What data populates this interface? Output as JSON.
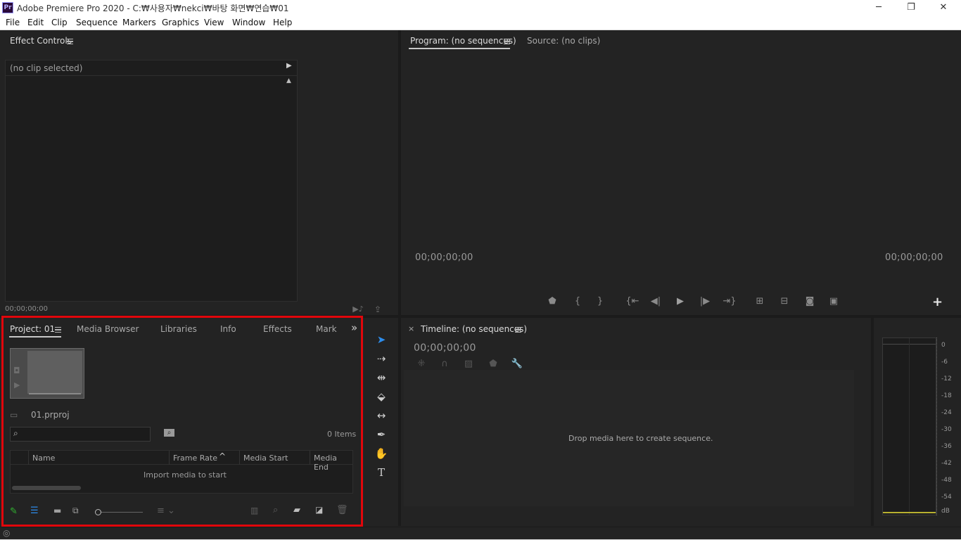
{
  "window": {
    "title": "Adobe Premiere Pro 2020 - C:₩사용자₩nekci₩바탕 화면₩연습₩01",
    "app_icon": "Pr",
    "minimize_icon": "─",
    "restore_icon": "❐",
    "close_icon": "✕"
  },
  "menu": [
    "File",
    "Edit",
    "Clip",
    "Sequence",
    "Markers",
    "Graphics",
    "View",
    "Window",
    "Help"
  ],
  "effect_controls": {
    "tab_label": "Effect Controls",
    "clip_selector": "(no clip selected)",
    "timecode": "00;00;00;00"
  },
  "program_monitor": {
    "tab_program": "Program: (no sequences)",
    "tab_source": "Source: (no clips)",
    "timecode_left": "00;00;00;00",
    "timecode_right": "00;00;00;00",
    "controls": [
      "marker-icon",
      "mark-in-icon",
      "mark-out-icon",
      "go-to-in-icon",
      "step-back-icon",
      "play-icon",
      "step-forward-icon",
      "go-to-out-icon",
      "lift-icon",
      "extract-icon",
      "export-frame-icon",
      "comparison-view-icon"
    ],
    "add_icon": "+"
  },
  "project": {
    "tabs": [
      "Project: 01",
      "Media Browser",
      "Libraries",
      "Info",
      "Effects",
      "Mark"
    ],
    "overflow_icon": "»",
    "filename": "01.prproj",
    "search_placeholder": "",
    "items_count": "0 Items",
    "columns": [
      "Name",
      "Frame Rate",
      "Media Start",
      "Media End"
    ],
    "empty_message": "Import media to start",
    "thumbnail_zoom": 0.0
  },
  "tools": [
    "selection-tool-icon",
    "track-select-tool-icon",
    "ripple-edit-tool-icon",
    "razor-tool-icon",
    "slip-tool-icon",
    "pen-tool-icon",
    "hand-tool-icon",
    "type-tool-icon"
  ],
  "timeline": {
    "close_icon": "×",
    "tab_label": "Timeline: (no sequences)",
    "timecode": "00;00;00;00",
    "drop_message": "Drop media here to create sequence."
  },
  "audio_meter": {
    "scale": [
      "0",
      "-6",
      "-12",
      "-18",
      "-24",
      "-30",
      "-36",
      "-42",
      "-48",
      "-54",
      "dB"
    ]
  },
  "colors": {
    "highlight_border": "#e1060b",
    "accent_blue": "#2d8ceb",
    "pencil_green": "#31b431"
  }
}
